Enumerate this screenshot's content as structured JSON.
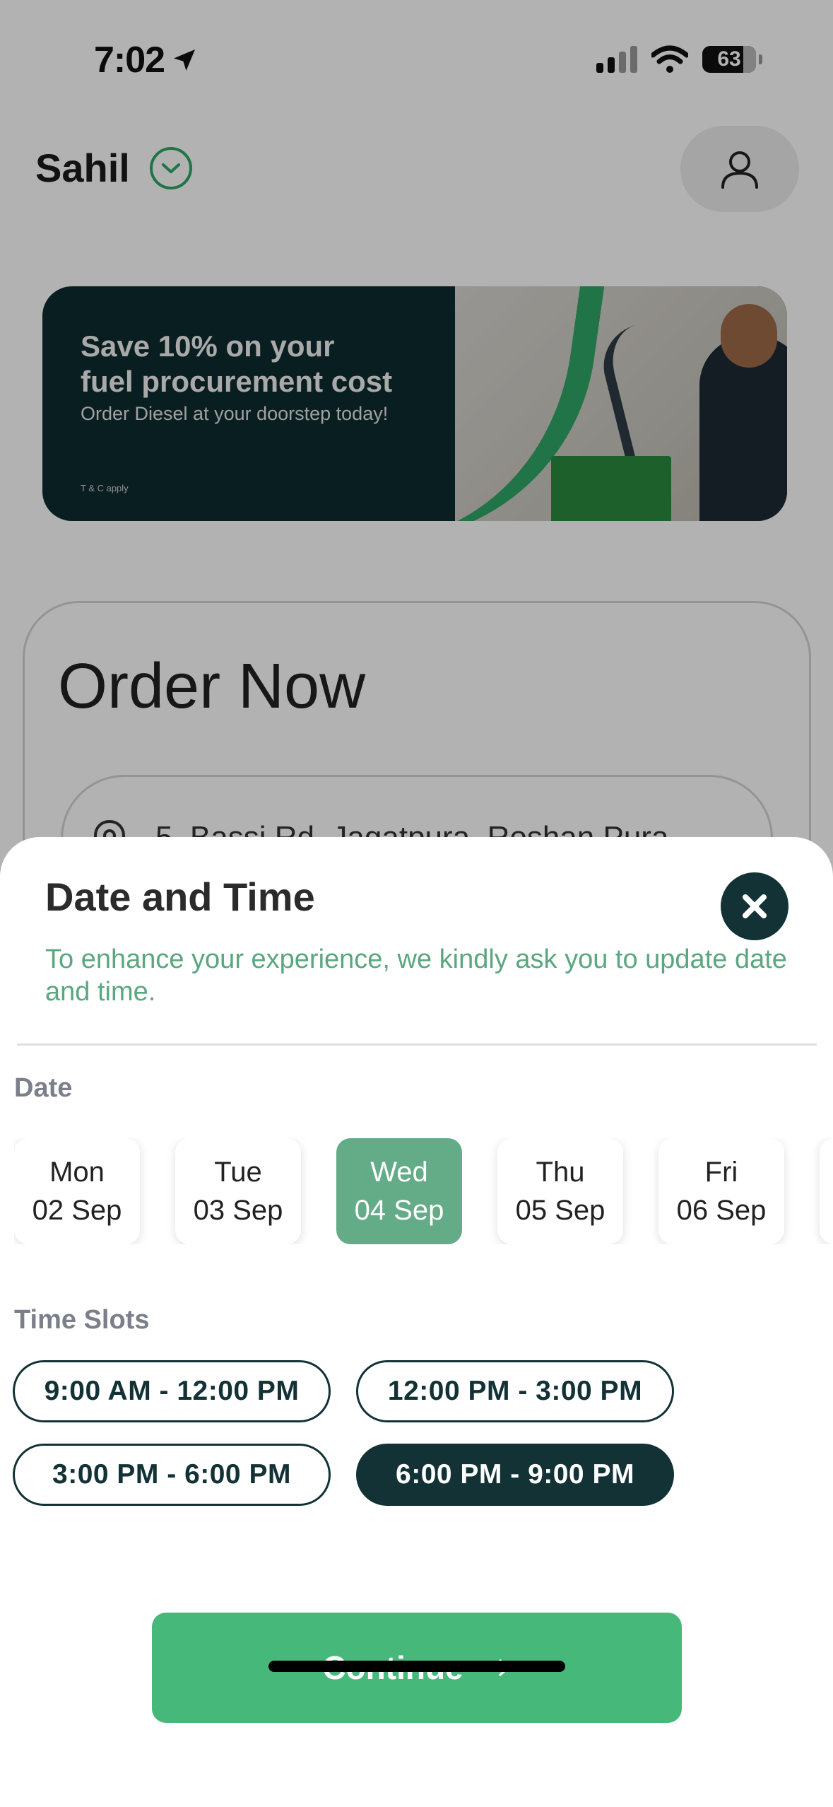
{
  "status_bar": {
    "time": "7:02",
    "battery": "63"
  },
  "header": {
    "user_name": "Sahil"
  },
  "banner": {
    "title_line1": "Save 10% on your",
    "title_line2": "fuel procurement cost",
    "subtitle": "Order Diesel at your doorstep today!",
    "terms": "T & C apply"
  },
  "order": {
    "title": "Order Now",
    "address_partial": "5, Bassi Rd, Jagatpura, Roshan Pura"
  },
  "sheet": {
    "title": "Date and Time",
    "description": "To enhance your experience, we kindly ask you to update date and time.",
    "date_label": "Date",
    "time_label": "Time Slots",
    "dates": [
      {
        "day": "Mon",
        "date": "02 Sep",
        "selected": false
      },
      {
        "day": "Tue",
        "date": "03 Sep",
        "selected": false
      },
      {
        "day": "Wed",
        "date": "04 Sep",
        "selected": true
      },
      {
        "day": "Thu",
        "date": "05 Sep",
        "selected": false
      },
      {
        "day": "Fri",
        "date": "06 Sep",
        "selected": false
      }
    ],
    "slots": [
      {
        "label": "9:00 AM - 12:00 PM",
        "selected": false
      },
      {
        "label": "12:00 PM - 3:00 PM",
        "selected": false
      },
      {
        "label": "3:00 PM - 6:00 PM",
        "selected": false
      },
      {
        "label": "6:00 PM - 9:00 PM",
        "selected": true
      }
    ],
    "continue_label": "Continue"
  },
  "colors": {
    "accent_green": "#46b87a",
    "dark_teal": "#123236",
    "selected_date": "#63ac87",
    "description_text": "#5aa77f"
  },
  "icons": {
    "location": "location-arrow-icon",
    "dropdown": "chevron-down-icon",
    "profile": "user-icon",
    "close": "close-icon",
    "continue": "arrow-right-icon",
    "pin": "map-pin-icon"
  }
}
